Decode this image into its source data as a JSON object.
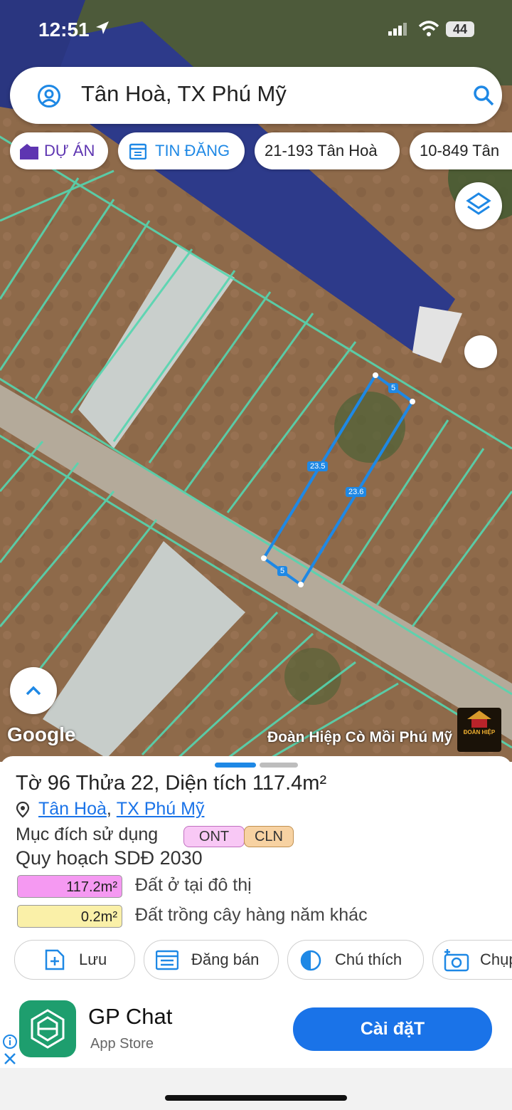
{
  "status_bar": {
    "time": "12:51",
    "battery": "44"
  },
  "search": {
    "text": "Tân Hoà, TX Phú Mỹ"
  },
  "chips": [
    {
      "label": "DỰ ÁN",
      "color": "#5e35b1"
    },
    {
      "label": "TIN ĐĂNG",
      "color": "#1e88e5"
    },
    {
      "label": "21-193 Tân Hoà"
    },
    {
      "label": "10-849 Tân"
    }
  ],
  "map": {
    "parcel_edges": [
      "5",
      "23.5",
      "23.6",
      "5"
    ],
    "parcel_color": "#1e88e5",
    "grid_color": "#55d6b0",
    "google_label": "Google",
    "watermark": "Đoàn Hiệp Cò Mồi Phú Mỹ",
    "watermark_logo_text": "ĐOÀN HIỆP"
  },
  "parcel": {
    "title": "Tờ 96 Thửa 22, Diện tích 117.4m²",
    "address": {
      "ward": "Tân Hoà",
      "separator": ", ",
      "district": "TX Phú Mỹ"
    },
    "purpose_label": "Mục đích sử dụng",
    "purpose_tags": [
      {
        "code": "ONT",
        "color": "#f8c8f5"
      },
      {
        "code": "CLN",
        "color": "#f7d2a2"
      }
    ],
    "plan_title": "Quy hoạch SDĐ 2030",
    "zones": [
      {
        "area": "117.2m²",
        "label": "Đất ở tại đô thị",
        "color": "#f599f2"
      },
      {
        "area": "0.2m²",
        "label": "Đất trồng cây hàng năm khác",
        "color": "#faf0a8"
      }
    ]
  },
  "actions": [
    {
      "label": "Lưu"
    },
    {
      "label": "Đăng bán"
    },
    {
      "label": "Chú thích"
    },
    {
      "label": "Chụp"
    }
  ],
  "ad": {
    "app_name": "GP Chat",
    "store": "App Store",
    "install_label": "Cài đặT"
  }
}
